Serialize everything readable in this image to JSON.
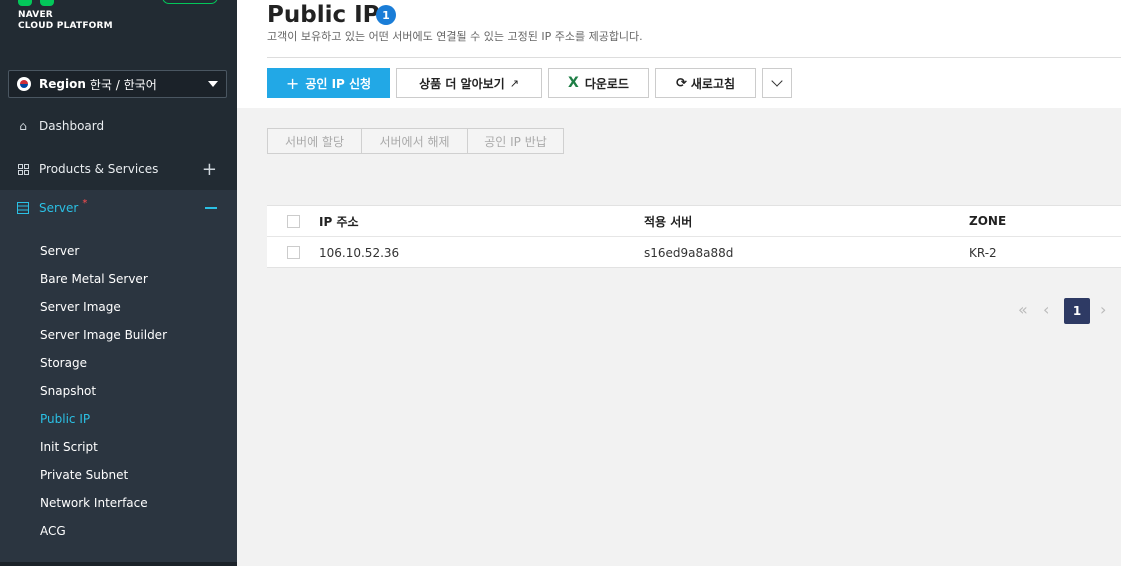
{
  "sidebar": {
    "brand_line1": "NAVER",
    "brand_line2": "CLOUD PLATFORM",
    "region": {
      "label": "Region",
      "value": "한국 / 한국어"
    },
    "nav": [
      {
        "label": "Dashboard",
        "icon": "home-icon"
      },
      {
        "label": "Products & Services",
        "icon": "grid-icon"
      },
      {
        "label": "Server",
        "icon": "server-icon",
        "marker": "*"
      }
    ],
    "server_items": [
      {
        "label": "Server"
      },
      {
        "label": "Bare Metal Server"
      },
      {
        "label": "Server Image"
      },
      {
        "label": "Server Image Builder"
      },
      {
        "label": "Storage"
      },
      {
        "label": "Snapshot"
      },
      {
        "label": "Public IP"
      },
      {
        "label": "Init Script"
      },
      {
        "label": "Private Subnet"
      },
      {
        "label": "Network Interface"
      },
      {
        "label": "ACG"
      }
    ],
    "active_item": "Public IP"
  },
  "page": {
    "title": "Public IP",
    "count": "1",
    "subtitle": "고객이 보유하고 있는 어떤 서버에도 연결될 수 있는 고정된 IP 주소를 제공합니다."
  },
  "toolbar": {
    "request_label": "공인 IP 신청",
    "learn_more_label": "상품 더 알아보기",
    "download_label": "다운로드",
    "refresh_label": "새로고침"
  },
  "actions": {
    "assign_label": "서버에 할당",
    "release_label": "서버에서 해제",
    "return_label": "공인 IP 반납"
  },
  "table": {
    "headers": [
      "IP 주소",
      "적용 서버",
      "ZONE"
    ],
    "rows": [
      [
        "106.10.52.36",
        "s16ed9a8a88d",
        "KR-2"
      ]
    ]
  },
  "pagination": {
    "current": "1"
  },
  "colors": {
    "sidebar_bg": "#222b33",
    "accent": "#2bc0e4",
    "primary_button": "#22a8e6",
    "page_badge": "#2e3a64"
  }
}
